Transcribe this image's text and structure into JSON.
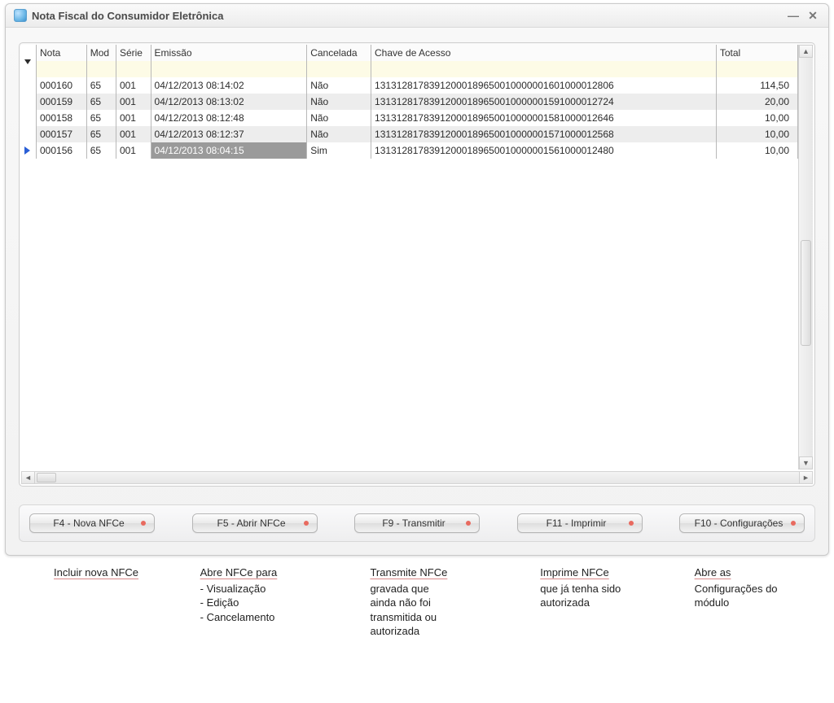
{
  "window": {
    "title": "Nota Fiscal do Consumidor Eletrônica"
  },
  "table": {
    "columns": {
      "nota": "Nota",
      "mod": "Mod",
      "serie": "Série",
      "emissao": "Emissão",
      "cancelada": "Cancelada",
      "chave": "Chave de Acesso",
      "total": "Total"
    },
    "rows": [
      {
        "nota": "000160",
        "mod": "65",
        "serie": "001",
        "emissao": "04/12/2013 08:14:02",
        "cancelada": "Não",
        "chave": "13131281783912000189650010000001601000012806",
        "total": "114,50"
      },
      {
        "nota": "000159",
        "mod": "65",
        "serie": "001",
        "emissao": "04/12/2013 08:13:02",
        "cancelada": "Não",
        "chave": "13131281783912000189650010000001591000012724",
        "total": "20,00"
      },
      {
        "nota": "000158",
        "mod": "65",
        "serie": "001",
        "emissao": "04/12/2013 08:12:48",
        "cancelada": "Não",
        "chave": "13131281783912000189650010000001581000012646",
        "total": "10,00"
      },
      {
        "nota": "000157",
        "mod": "65",
        "serie": "001",
        "emissao": "04/12/2013 08:12:37",
        "cancelada": "Não",
        "chave": "13131281783912000189650010000001571000012568",
        "total": "10,00"
      },
      {
        "nota": "000156",
        "mod": "65",
        "serie": "001",
        "emissao": "04/12/2013 08:04:15",
        "cancelada": "Sim",
        "chave": "13131281783912000189650010000001561000012480",
        "total": "10,00"
      }
    ],
    "selected_row_index": 4
  },
  "buttons": {
    "f4": "F4 - Nova NFCe",
    "f5": "F5 - Abrir NFCe",
    "f9": "F9 - Transmitir",
    "f11": "F11 - Imprimir",
    "f10": "F10 - Configurações"
  },
  "annotations": {
    "a1": {
      "title": "Incluir nova NFCe",
      "lines": []
    },
    "a2": {
      "title": "Abre NFCe para",
      "lines": [
        "- Visualização",
        "- Edição",
        "- Cancelamento"
      ]
    },
    "a3": {
      "title": "",
      "lines": [
        "Transmite NFCe",
        "gravada que",
        "ainda não foi",
        "transmitida ou",
        "autorizada"
      ]
    },
    "a4": {
      "title": "",
      "lines": [
        "Imprime NFCe",
        "que já tenha sido",
        "autorizada"
      ]
    },
    "a5": {
      "title": "",
      "lines": [
        "Abre as",
        "Configurações do",
        "módulo"
      ]
    }
  }
}
